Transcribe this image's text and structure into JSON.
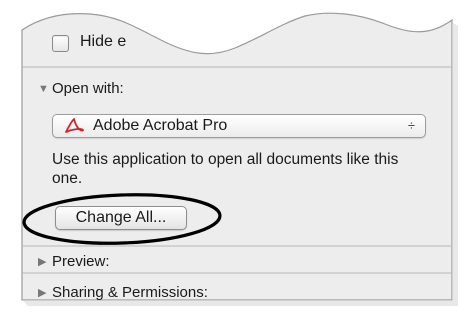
{
  "hide_extension": {
    "label": "Hide e",
    "checked": false
  },
  "open_with": {
    "header": "Open with:",
    "application": {
      "label": "Adobe Acrobat Pro",
      "icon": "adobe-acrobat-icon"
    },
    "description": "Use this application to open all documents like this one.",
    "change_all_label": "Change All..."
  },
  "preview": {
    "header": "Preview:"
  },
  "sharing": {
    "header": "Sharing & Permissions:"
  },
  "colors": {
    "panel": "#ededed",
    "border": "#b8b8b8",
    "annotation": "#000000",
    "acrobat_red": "#d4242b"
  }
}
